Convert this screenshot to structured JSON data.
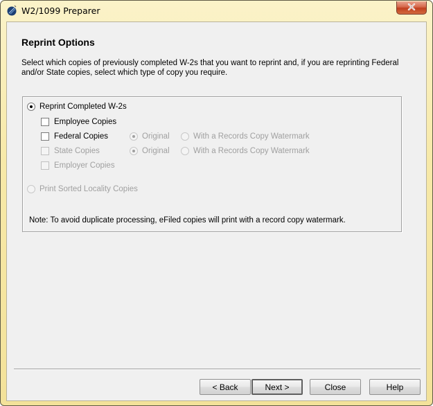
{
  "window": {
    "title": "W2/1099 Preparer",
    "app_icon": "app-logo-icon",
    "close_icon": "close-icon"
  },
  "page": {
    "title": "Reprint Options",
    "intro": "Select which copies of previously completed W-2s that you want to reprint and, if you are reprinting Federal and/or State copies, select which type of copy you require."
  },
  "options": {
    "reprint_completed": {
      "label": "Reprint Completed W-2s",
      "selected": true,
      "enabled": true
    },
    "employee_copies": {
      "label": "Employee Copies",
      "checked": false,
      "enabled": true
    },
    "federal_copies": {
      "label": "Federal Copies",
      "checked": false,
      "enabled": true,
      "original": {
        "label": "Original",
        "selected": true,
        "enabled": false
      },
      "watermark": {
        "label": "With a Records Copy Watermark",
        "selected": false,
        "enabled": false
      }
    },
    "state_copies": {
      "label": "State Copies",
      "checked": false,
      "enabled": false,
      "original": {
        "label": "Original",
        "selected": true,
        "enabled": false
      },
      "watermark": {
        "label": "With a Records Copy Watermark",
        "selected": false,
        "enabled": false
      }
    },
    "employer_copies": {
      "label": "Employer Copies",
      "checked": false,
      "enabled": false
    },
    "print_sorted_locality": {
      "label": "Print Sorted Locality Copies",
      "selected": false,
      "enabled": false
    },
    "note": "Note: To avoid duplicate processing, eFiled copies will print with a record copy watermark."
  },
  "buttons": {
    "back": "< Back",
    "next": "Next >",
    "close": "Close",
    "help": "Help"
  }
}
